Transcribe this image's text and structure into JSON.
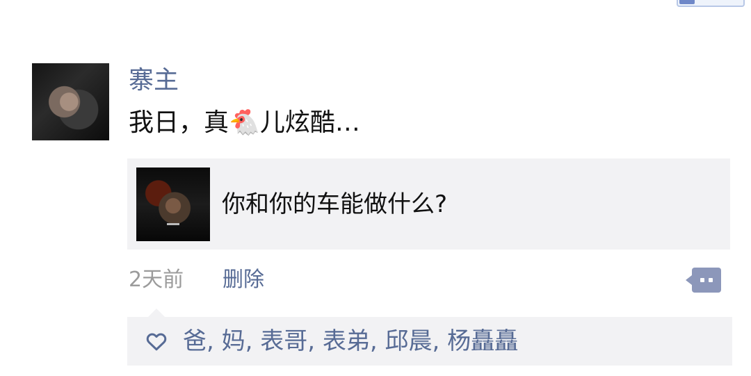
{
  "post": {
    "user": "寨主",
    "text_before_emoji": "我日，真",
    "emoji": "🐔",
    "text_after_emoji": "儿炫酷…"
  },
  "link_card": {
    "title": "你和你的车能做什么?"
  },
  "meta": {
    "time": "2天前",
    "delete_label": "删除"
  },
  "likes": {
    "names": [
      "爸",
      "妈",
      "表哥",
      "表弟",
      "邱晨",
      "杨矗矗"
    ],
    "separator": ", "
  },
  "colors": {
    "link_blue": "#576b95",
    "text_dark": "#111111",
    "meta_gray": "#9b9b9b",
    "panel_gray": "#f2f2f4",
    "action_button": "#8c97ba"
  }
}
